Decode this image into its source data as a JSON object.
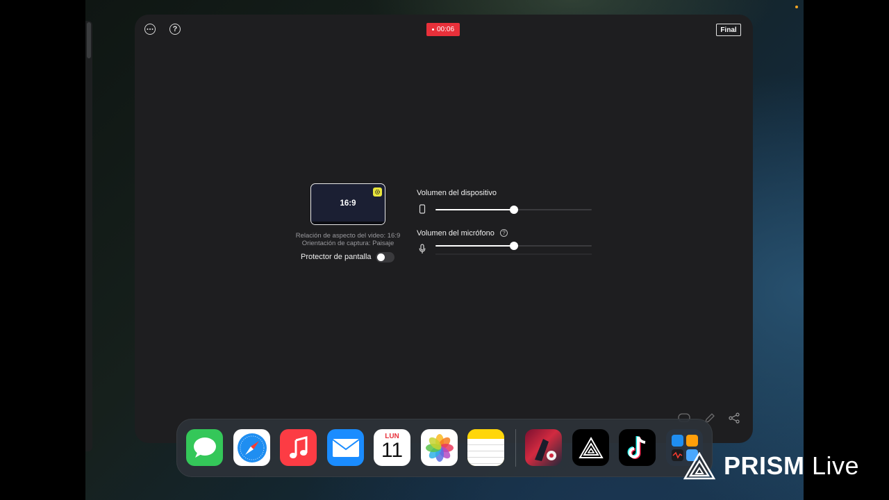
{
  "app": {
    "recording_time": "00:06",
    "final_label": "Final",
    "more_icon": "ellipsis-circle-icon",
    "help_icon": "question-circle-icon",
    "help_symbol": "?"
  },
  "preview": {
    "ratio": "16:9",
    "aspect_text": "Relación de aspecto del video: 16:9",
    "orientation_text": "Orientación de captura: Paisaje",
    "protector_label": "Protector de pantalla",
    "protector_on": false
  },
  "volume": {
    "device_label": "Volumen del dispositivo",
    "device_level": 0.5,
    "mic_label": "Volumen del micrófono",
    "mic_level": 0.5
  },
  "dock": {
    "apps": [
      {
        "name": "messages-app-icon",
        "color": "#34c759"
      },
      {
        "name": "safari-app-icon",
        "color": "#ffffff"
      },
      {
        "name": "music-app-icon",
        "color": "#fc3c44"
      },
      {
        "name": "mail-app-icon",
        "color": "#1a8cff"
      },
      {
        "name": "calendar-app-icon",
        "color": "#ffffff"
      },
      {
        "name": "photos-app-icon",
        "color": "#ffffff"
      },
      {
        "name": "notes-app-icon",
        "color": "#ffd60a"
      },
      {
        "name": "free-fire-max-app-icon",
        "color": "#c8203a"
      },
      {
        "name": "prism-live-app-icon",
        "color": "#000000"
      },
      {
        "name": "tiktok-app-icon",
        "color": "#000000"
      },
      {
        "name": "app-folder-icon",
        "color": "#2a3440"
      }
    ],
    "calendar_day": "LUN",
    "calendar_date": "11"
  },
  "watermark": {
    "brand": "PRISM",
    "suffix": "Live"
  },
  "colors": {
    "recording": "#e8303a",
    "accent_yellow": "#e9e63c",
    "window_bg": "#1e1e20"
  }
}
